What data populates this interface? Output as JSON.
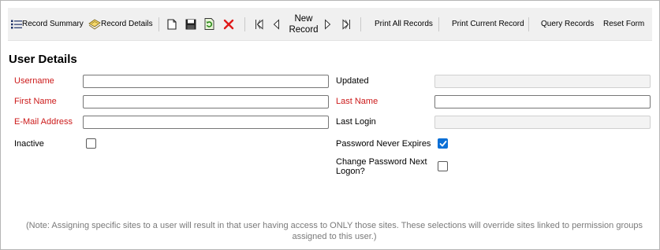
{
  "toolbar": {
    "record_summary": "Record Summary",
    "record_details": "Record Details",
    "new_record_line1": "New",
    "new_record_line2": "Record",
    "print_all": "Print All Records",
    "print_current": "Print Current Record",
    "query": "Query Records",
    "reset": "Reset Form"
  },
  "form": {
    "title": "User Details",
    "username_label": "Username",
    "username_value": "",
    "first_name_label": "First Name",
    "first_name_value": "",
    "email_label": "E-Mail Address",
    "email_value": "",
    "inactive_label": "Inactive",
    "inactive_checked": false,
    "updated_label": "Updated",
    "updated_value": "",
    "last_name_label": "Last Name",
    "last_name_value": "",
    "last_login_label": "Last Login",
    "last_login_value": "",
    "password_never_expires_label": "Password Never Expires",
    "password_never_expires_checked": true,
    "change_password_label_line1": "Change Password Next",
    "change_password_label_line2": "Logon?",
    "change_password_checked": false
  },
  "note": "(Note: Assigning specific sites to a user will result in that user having access to ONLY those sites. These selections will override sites linked to permission groups assigned to this user.)",
  "colors": {
    "required_label": "#cc1a1a",
    "checkbox_checked": "#0a6fd6",
    "delete_icon": "#e01a1a"
  },
  "icons": [
    "list-icon",
    "record-details-icon",
    "new-document-icon",
    "save-icon",
    "refresh-icon",
    "delete-icon",
    "first-record-icon",
    "previous-record-icon",
    "next-record-icon",
    "last-record-icon"
  ]
}
